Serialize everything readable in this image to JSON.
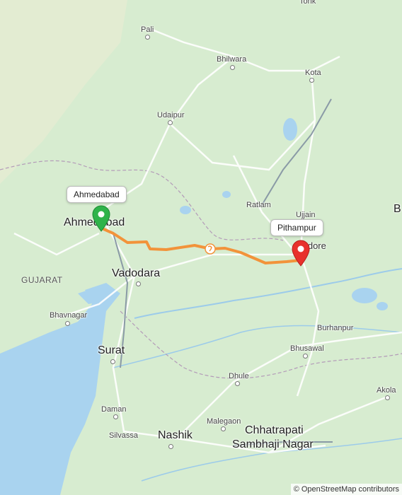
{
  "map": {
    "start": {
      "label": "Ahmedabad",
      "pin_color": "#2fb34a"
    },
    "end": {
      "label": "Pithampur",
      "pin_color": "#e8312c"
    },
    "route_color": "#f2933a",
    "water_color": "#a9d3ef",
    "land_color": "#d7ecd0"
  },
  "cities": {
    "tonk": "Tonk",
    "pali": "Pali",
    "bhilwara": "Bhilwara",
    "kota": "Kota",
    "udaipur": "Udaipur",
    "ahmedabad": "Ahmedabad",
    "ratlam": "Ratlam",
    "ujjain": "Ujjain",
    "indore": "Indore",
    "b": "B",
    "vadodara": "Vadodara",
    "gujarat": "GUJARAT",
    "bhavnagar": "Bhavnagar",
    "surat": "Surat",
    "burhanpur": "Burhanpur",
    "bhusawal": "Bhusawal",
    "dhule": "Dhule",
    "akola": "Akola",
    "malegaon": "Malegaon",
    "daman": "Daman",
    "silvassa": "Silvassa",
    "nashik": "Nashik",
    "chhatrapati": "Chhatrapati",
    "sambhaji": "Sambhaji Nagar"
  },
  "attribution": {
    "symbol": "©",
    "text": "OpenStreetMap contributors"
  }
}
